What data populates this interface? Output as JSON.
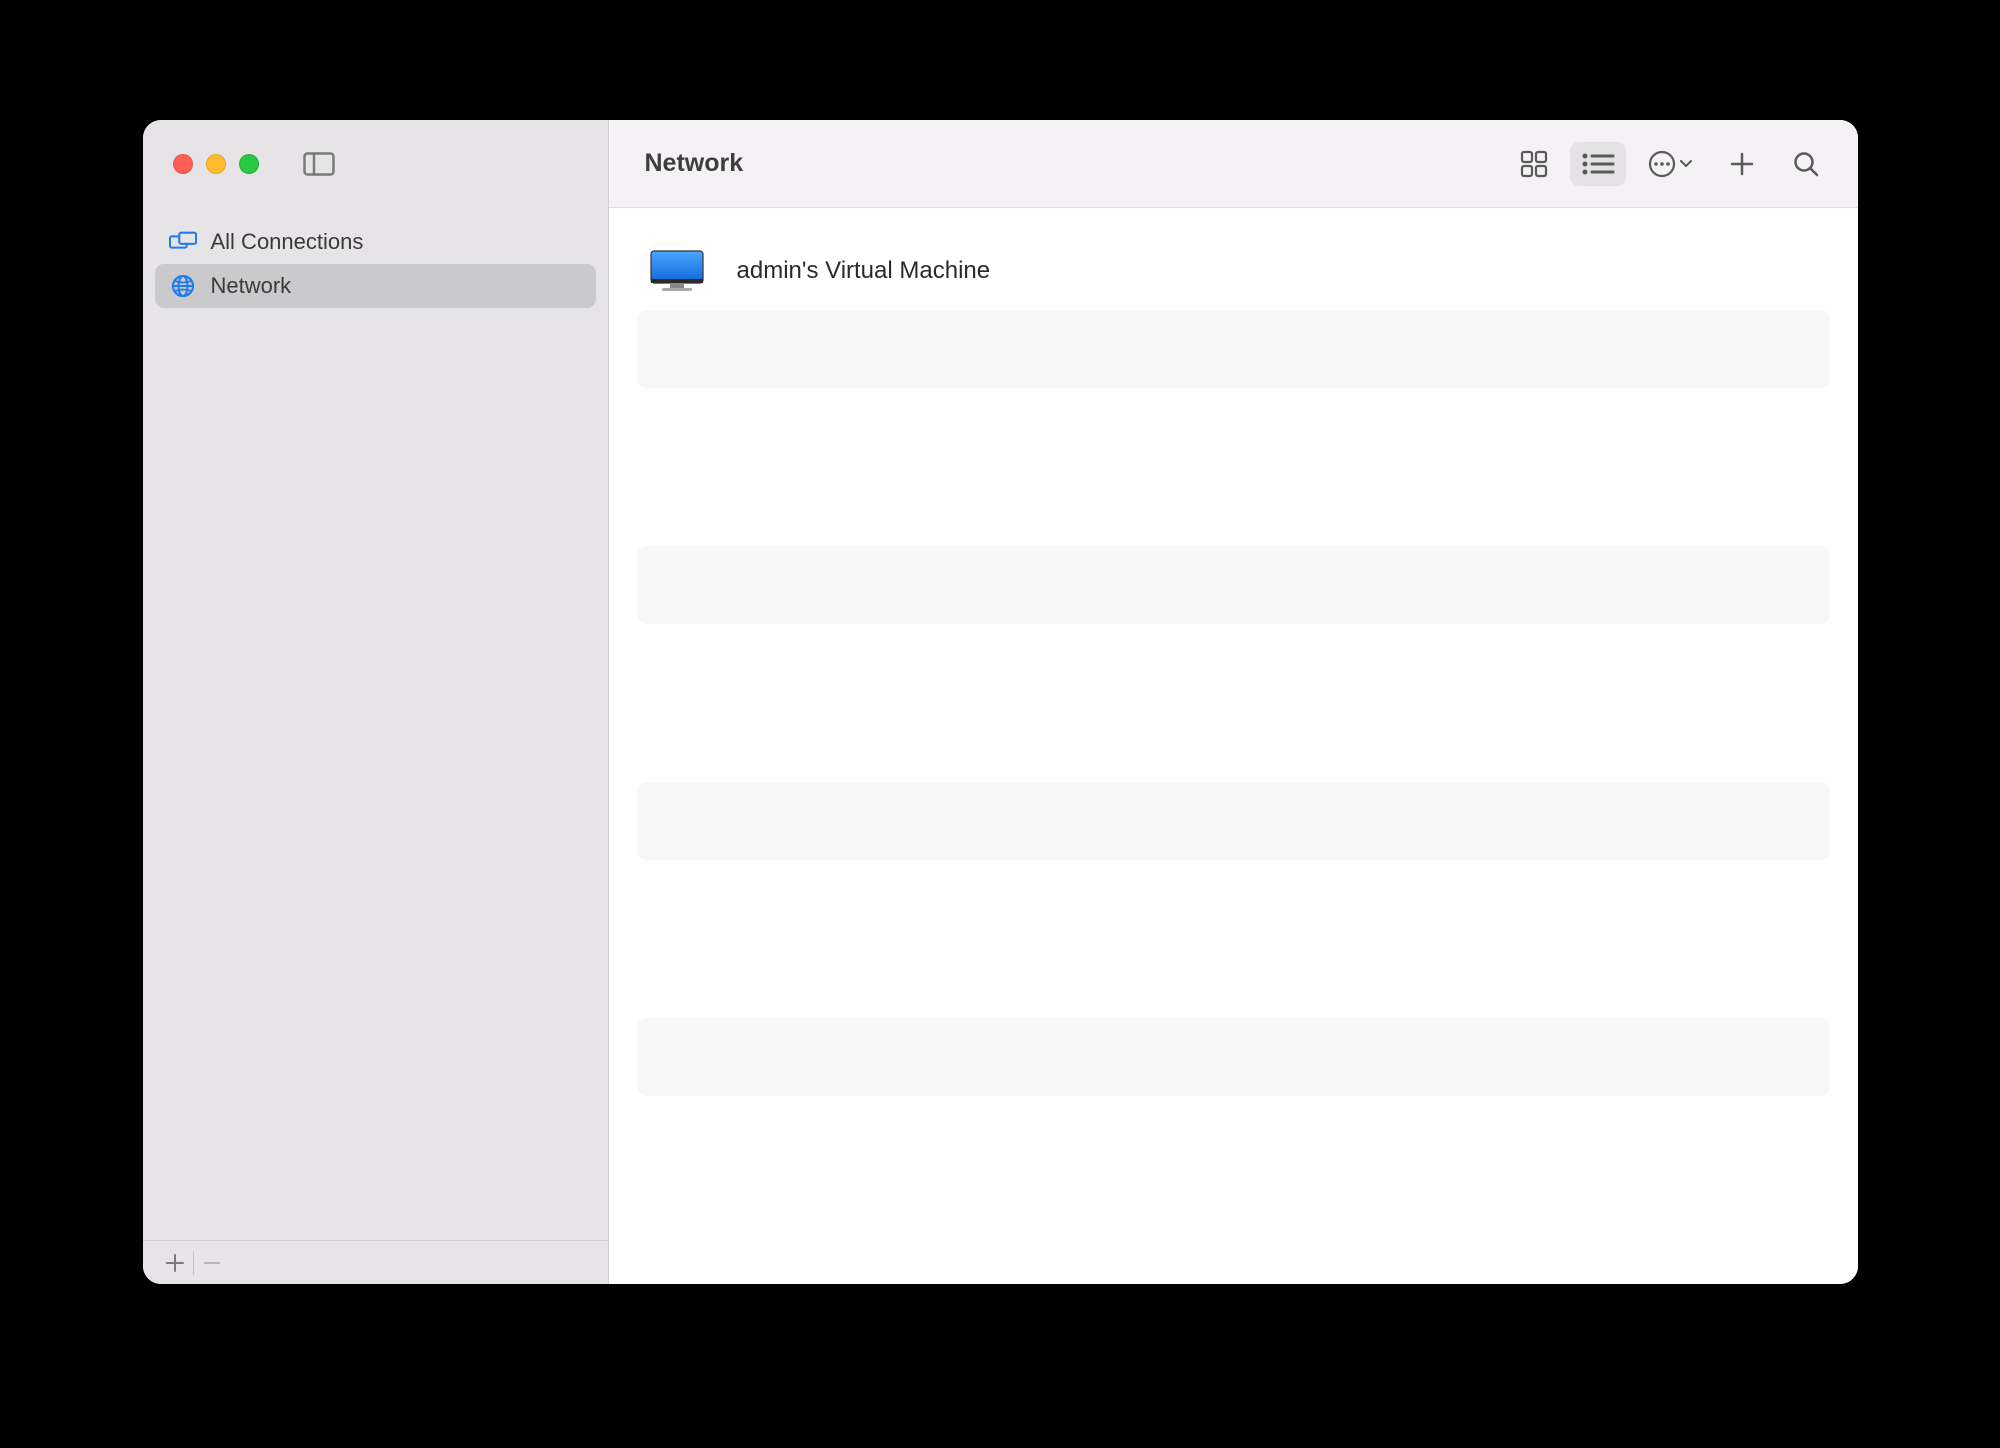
{
  "window": {
    "title": "Network"
  },
  "sidebar": {
    "items": [
      {
        "label": "All Connections",
        "icon": "monitors",
        "selected": false
      },
      {
        "label": "Network",
        "icon": "globe",
        "selected": true
      }
    ]
  },
  "content": {
    "items": [
      {
        "name": "admin's Virtual Machine"
      }
    ]
  }
}
